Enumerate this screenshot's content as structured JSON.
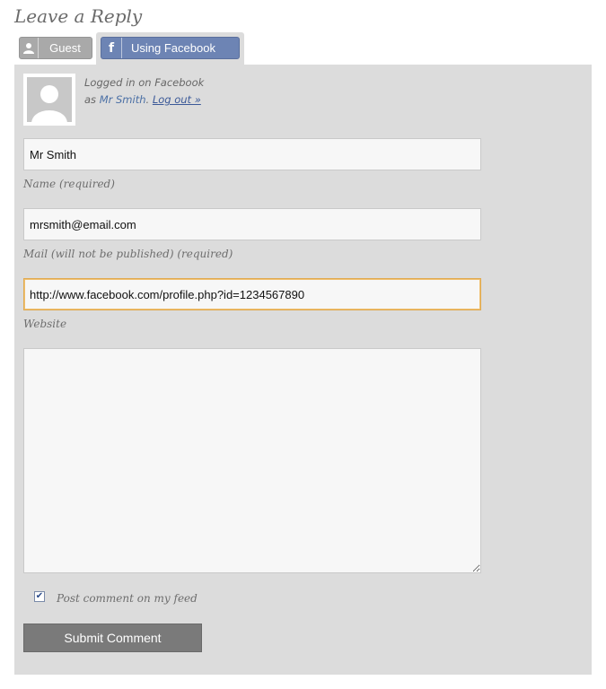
{
  "heading": "Leave a Reply",
  "tabs": {
    "guest": {
      "label": "Guest",
      "icon": "user-silhouette-icon"
    },
    "facebook": {
      "label": "Using Facebook",
      "icon": "facebook-f-icon",
      "active": true
    }
  },
  "login": {
    "line1": "Logged in on Facebook",
    "as_prefix": "as",
    "user_name": "Mr Smith",
    "separator": ".",
    "logout_label": "Log out »"
  },
  "form": {
    "name": {
      "value": "Mr Smith",
      "caption": "Name (required)"
    },
    "mail": {
      "value": "mrsmith@email.com",
      "caption": "Mail (will not be published) (required)"
    },
    "website": {
      "value": "http://www.facebook.com/profile.php?id=1234567890",
      "caption": "Website"
    },
    "comment": {
      "value": ""
    },
    "post_on_feed": {
      "checked": true,
      "label": "Post comment on my feed"
    },
    "submit_label": "Submit Comment"
  },
  "colors": {
    "panel_bg": "#dcdcdc",
    "facebook_blue": "#6d84b4",
    "guest_gray": "#a9a9a9",
    "submit_gray": "#7a7a7a",
    "focus_border": "#e0aa50"
  }
}
